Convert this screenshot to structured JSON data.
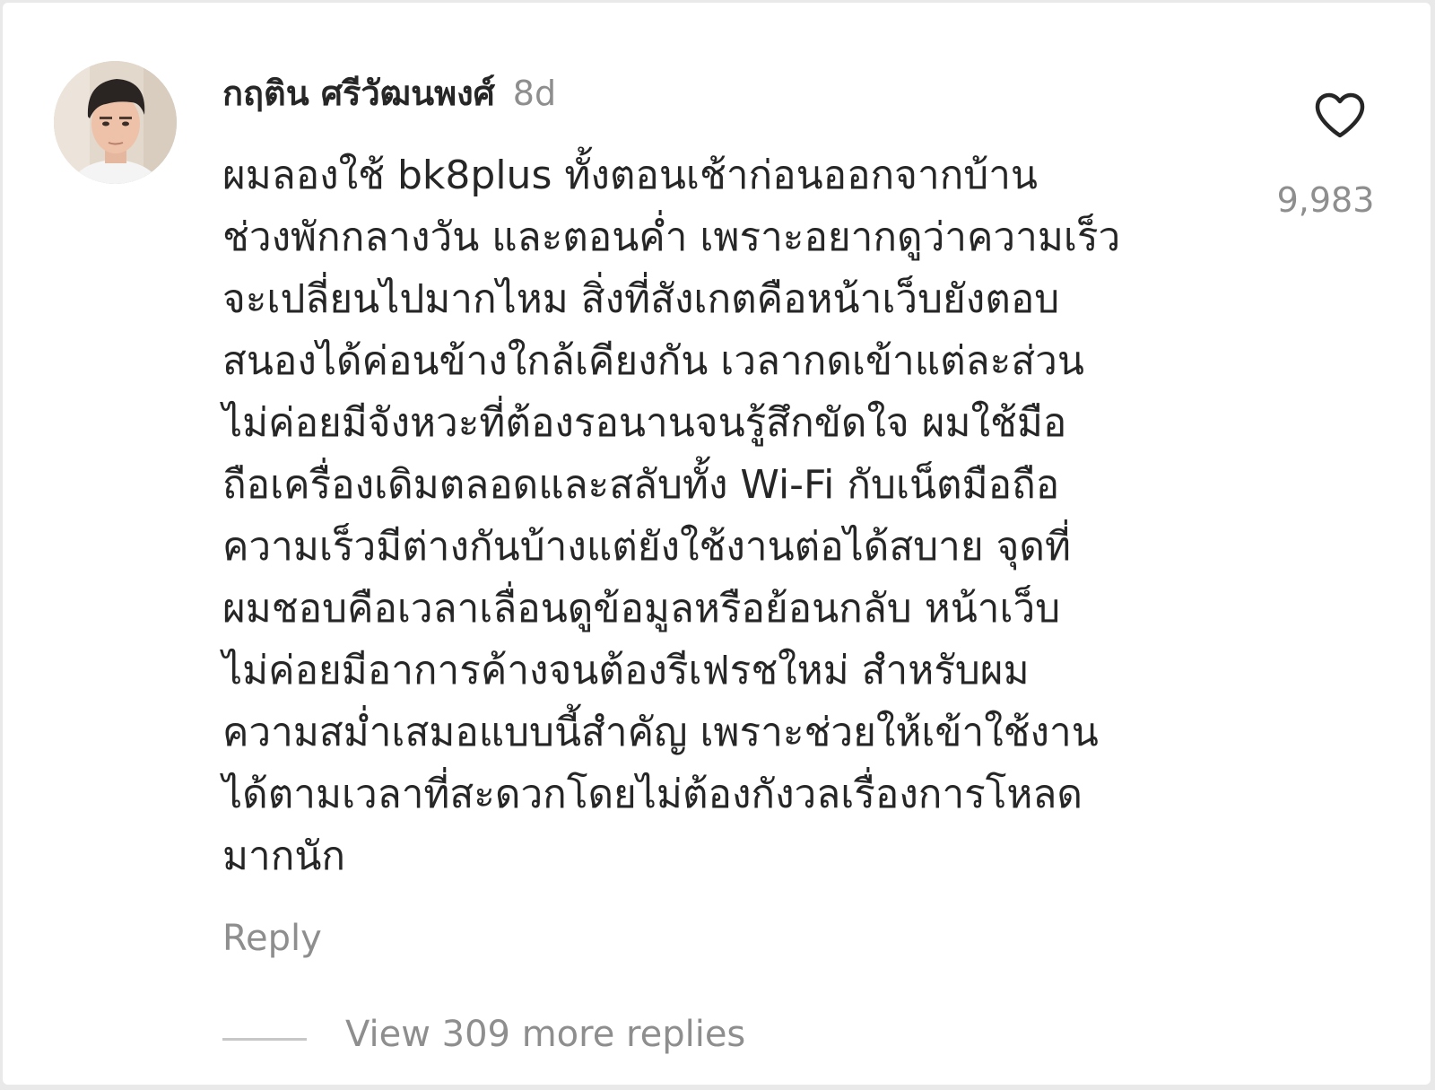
{
  "comment": {
    "username": "กฤติน ศรีวัฒนพงศ์",
    "timestamp": "8d",
    "lines": [
      "ผมลองใช้ bk8plus ทั้งตอนเช้าก่อนออกจากบ้าน",
      "ช่วงพักกลางวัน และตอนค่ำ เพราะอยากดูว่าความเร็ว",
      "จะเปลี่ยนไปมากไหม สิ่งที่สังเกตคือหน้าเว็บยังตอบ",
      "สนองได้ค่อนข้างใกล้เคียงกัน เวลากดเข้าแต่ละส่วน",
      "ไม่ค่อยมีจังหวะที่ต้องรอนานจนรู้สึกขัดใจ ผมใช้มือ",
      "ถือเครื่องเดิมตลอดและสลับทั้ง Wi-Fi กับเน็ตมือถือ",
      "ความเร็วมีต่างกันบ้างแต่ยังใช้งานต่อได้สบาย จุดที่",
      "ผมชอบคือเวลาเลื่อนดูข้อมูลหรือย้อนกลับ หน้าเว็บ",
      "ไม่ค่อยมีอาการค้างจนต้องรีเฟรชใหม่ สำหรับผม",
      "ความสม่ำเสมอแบบนี้สำคัญ เพราะช่วยให้เข้าใช้งาน",
      "ได้ตามเวลาที่สะดวกโดยไม่ต้องกังวลเรื่องการโหลด",
      "มากนัก"
    ],
    "like_icon": "heart-outline-icon",
    "like_count": "9,983",
    "reply_label": "Reply",
    "view_replies_label": "View 309 more replies"
  },
  "colors": {
    "text_primary": "#262626",
    "text_secondary": "#8e8e8e",
    "divider": "#c7c7c7"
  }
}
